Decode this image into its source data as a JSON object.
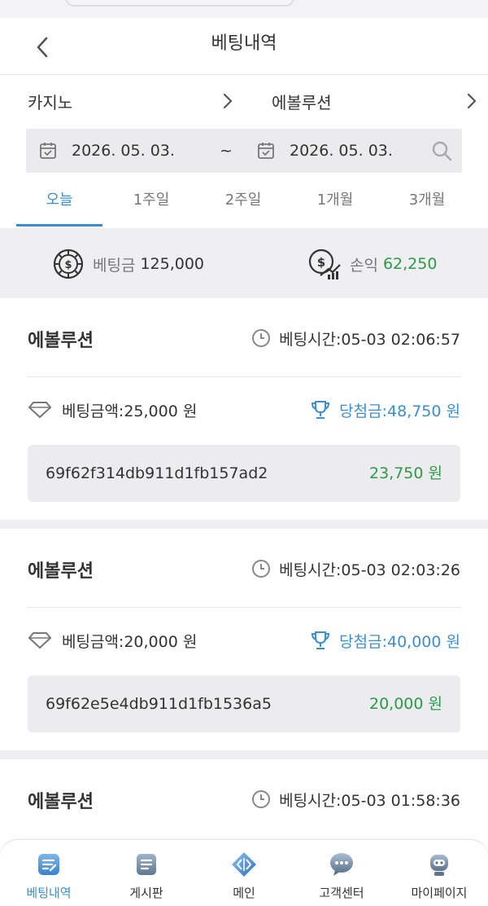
{
  "header": {
    "title": "베팅내역"
  },
  "filter": {
    "category": "카지노",
    "game": "에볼루션",
    "date_from": "2026. 05. 03.",
    "date_sep": "~",
    "date_to": "2026. 05. 03."
  },
  "tabs": [
    {
      "label": "오늘",
      "active": true
    },
    {
      "label": "1주일",
      "active": false
    },
    {
      "label": "2주일",
      "active": false
    },
    {
      "label": "1개월",
      "active": false
    },
    {
      "label": "3개월",
      "active": false
    }
  ],
  "summary": {
    "bet_label": "베팅금",
    "bet_value": "125,000",
    "profit_label": "손익",
    "profit_value": "62,250"
  },
  "bets": [
    {
      "game": "에볼루션",
      "time": "베팅시간:05-03 02:06:57",
      "amount": "베팅금액:25,000 원",
      "win": "당첨금:48,750 원",
      "id": "69f62f314db911d1fb157ad2",
      "profit": "23,750 원"
    },
    {
      "game": "에볼루션",
      "time": "베팅시간:05-03 02:03:26",
      "amount": "베팅금액:20,000 원",
      "win": "당첨금:40,000 원",
      "id": "69f62e5e4db911d1fb1536a5",
      "profit": "20,000 원"
    },
    {
      "game": "에볼루션",
      "time": "베팅시간:05-03 01:58:36"
    }
  ],
  "nav": [
    {
      "label": "베팅내역",
      "icon": "bet-history-icon",
      "active": true
    },
    {
      "label": "게시판",
      "icon": "board-icon",
      "active": false
    },
    {
      "label": "메인",
      "icon": "main-diamond-icon",
      "active": false
    },
    {
      "label": "고객센터",
      "icon": "chat-icon",
      "active": false
    },
    {
      "label": "마이페이지",
      "icon": "robot-avatar-icon",
      "active": false
    }
  ],
  "colors": {
    "accent": "#3a8fd2",
    "profit_green": "#2c9a48",
    "background": "#efeff2"
  }
}
